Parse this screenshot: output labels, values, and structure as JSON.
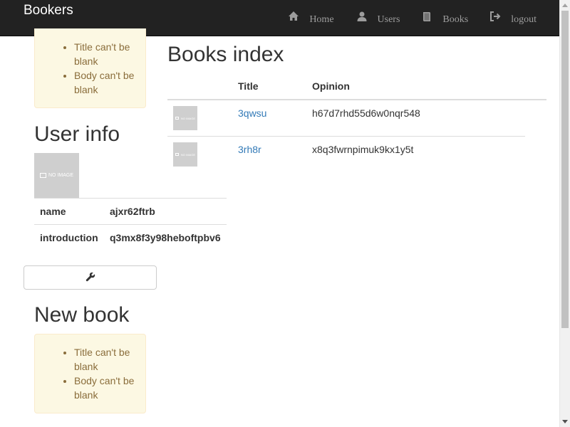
{
  "navbar": {
    "brand": "Bookers",
    "items": [
      {
        "label": "Home",
        "icon": "home-icon"
      },
      {
        "label": "Users",
        "icon": "user-icon"
      },
      {
        "label": "Books",
        "icon": "book-icon"
      },
      {
        "label": "logout",
        "icon": "logout-icon"
      }
    ]
  },
  "errors_top": [
    "Title can't be blank",
    "Body can't be blank"
  ],
  "user_info": {
    "heading": "User info",
    "avatar_text": "NO IMAGE",
    "rows": [
      {
        "key": "name",
        "value": "ajxr62ftrb"
      },
      {
        "key": "introduction",
        "value": "q3mx8f3y98heboftpbv6"
      }
    ],
    "edit_icon": "wrench-icon"
  },
  "new_book": {
    "heading": "New book",
    "errors": [
      "Title can't be blank",
      "Body can't be blank"
    ]
  },
  "books_index": {
    "heading": "Books index",
    "columns": [
      "",
      "Title",
      "Opinion"
    ],
    "rows": [
      {
        "image_text": "NO IMAGE",
        "title": "3qwsu",
        "opinion": "h67d7rhd55d6w0nqr548"
      },
      {
        "image_text": "NO IMAGE",
        "title": "3rh8r",
        "opinion": "x8q3fwrnpimuk9kx1y5t"
      }
    ]
  },
  "colors": {
    "navbar_bg": "#222222",
    "link": "#337ab7",
    "alert_bg": "#fcf8e3",
    "alert_text": "#8a6d3b"
  }
}
